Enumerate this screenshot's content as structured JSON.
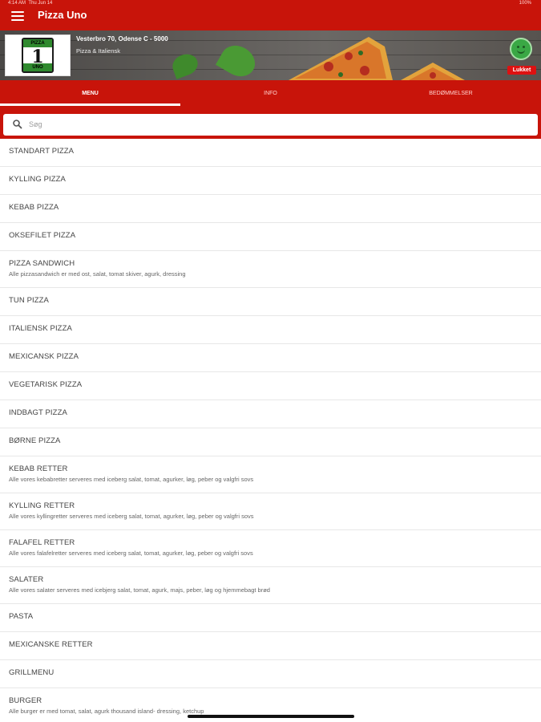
{
  "status": {
    "time": "4:14 AM",
    "date": "Thu Jun 14",
    "battery": "100%"
  },
  "app": {
    "title": "Pizza Uno"
  },
  "restaurant": {
    "logo_top": "PIZZA",
    "logo_number": "1",
    "logo_bottom": "UNO",
    "address": "Vesterbro 70, Odense C - 5000",
    "cuisine": "Pizza & Italiensk",
    "status_label": "Lukket"
  },
  "tabs": [
    {
      "label": "MENU"
    },
    {
      "label": "INFO"
    },
    {
      "label": "BEDØMMELSER"
    }
  ],
  "search": {
    "placeholder": "Søg"
  },
  "menu_items": [
    {
      "name": "STANDART PIZZA",
      "desc": ""
    },
    {
      "name": "KYLLING PIZZA",
      "desc": ""
    },
    {
      "name": "KEBAB PIZZA",
      "desc": ""
    },
    {
      "name": "OKSEFILET PIZZA",
      "desc": ""
    },
    {
      "name": "PIZZA SANDWICH",
      "desc": "Alle pizzasandwich er med ost, salat, tomat skiver, agurk, dressing"
    },
    {
      "name": "TUN PIZZA",
      "desc": ""
    },
    {
      "name": "ITALIENSK PIZZA",
      "desc": ""
    },
    {
      "name": "MEXICANSK PIZZA",
      "desc": ""
    },
    {
      "name": "VEGETARISK PIZZA",
      "desc": ""
    },
    {
      "name": "INDBAGT PIZZA",
      "desc": ""
    },
    {
      "name": "BØRNE PIZZA",
      "desc": ""
    },
    {
      "name": "KEBAB RETTER",
      "desc": "Alle vores kebabretter serveres med iceberg salat, tomat, agurker, løg, peber og valgfri sovs"
    },
    {
      "name": "KYLLING RETTER",
      "desc": "Alle vores kyllingretter serveres med iceberg salat, tomat, agurker, løg, peber og valgfri sovs"
    },
    {
      "name": "FALAFEL RETTER",
      "desc": "Alle vores falafelretter serveres med iceberg salat, tomat, agurker, løg, peber og valgfri sovs"
    },
    {
      "name": "SALATER",
      "desc": "Alle vores salater serveres med icebjerg salat, tomat, agurk, majs, peber, løg og hjemmebagt brød"
    },
    {
      "name": "PASTA",
      "desc": ""
    },
    {
      "name": "MEXICANSKE RETTER",
      "desc": ""
    },
    {
      "name": "GRILLMENU",
      "desc": ""
    },
    {
      "name": "BURGER",
      "desc": "Alle burger er med tomat, salat, agurk thousand island- dressing, ketchup"
    }
  ],
  "colors": {
    "brand_red": "#c8140a",
    "status_green": "#3aa845",
    "closed_red": "#dd1111"
  },
  "icons": {
    "menu": "hamburger-icon",
    "search": "search-icon",
    "status": "smiley-icon"
  }
}
